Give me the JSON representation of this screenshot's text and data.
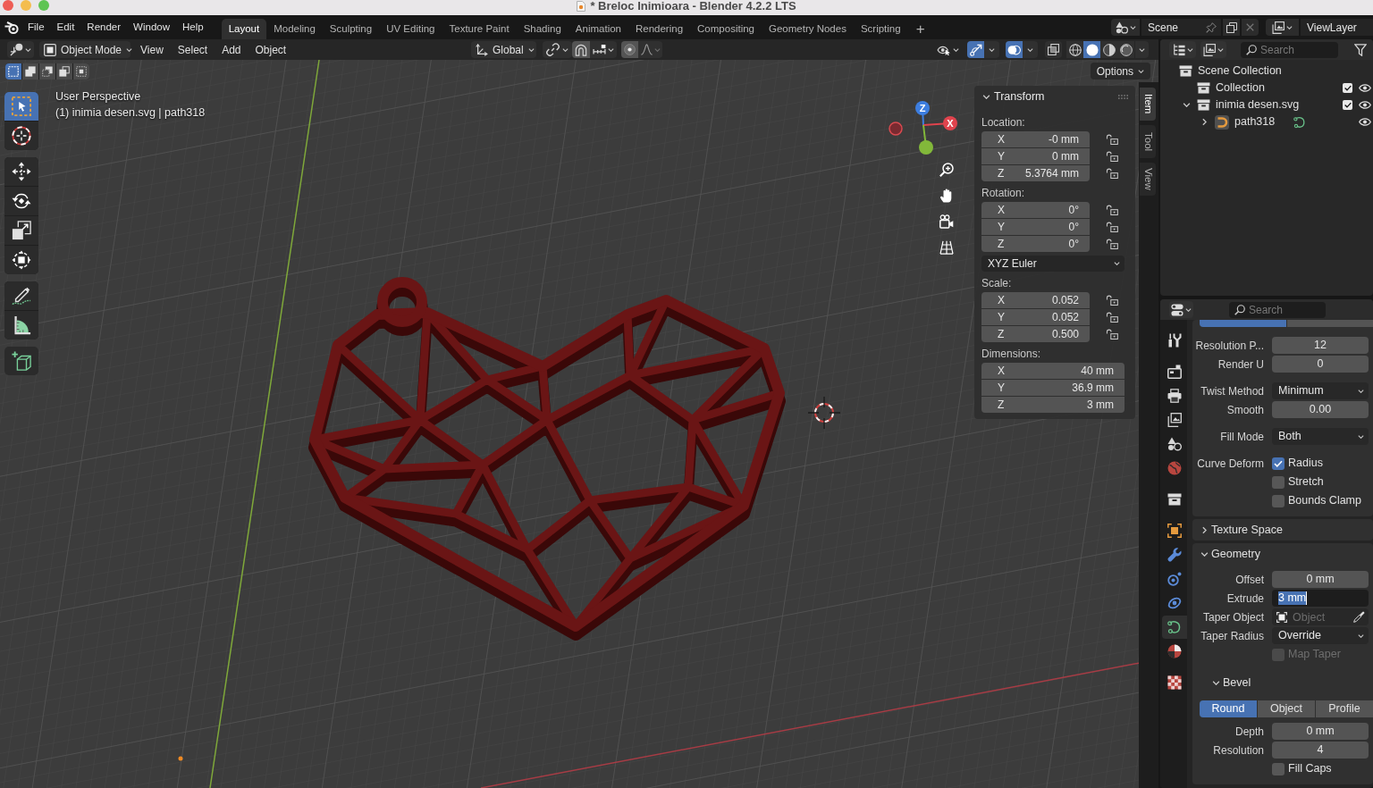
{
  "window": {
    "title": "* Breloc Inimioara - Blender 4.2.2 LTS"
  },
  "top_bar": {
    "menus": [
      "File",
      "Edit",
      "Render",
      "Window",
      "Help"
    ],
    "workspaces": [
      {
        "label": "Layout",
        "selected": true
      },
      {
        "label": "Modeling",
        "selected": false
      },
      {
        "label": "Sculpting",
        "selected": false
      },
      {
        "label": "UV Editing",
        "selected": false
      },
      {
        "label": "Texture Paint",
        "selected": false
      },
      {
        "label": "Shading",
        "selected": false
      },
      {
        "label": "Animation",
        "selected": false
      },
      {
        "label": "Rendering",
        "selected": false
      },
      {
        "label": "Compositing",
        "selected": false
      },
      {
        "label": "Geometry Nodes",
        "selected": false
      },
      {
        "label": "Scripting",
        "selected": false
      }
    ],
    "add_workspace": "+",
    "scene": "Scene",
    "view_layer": "ViewLayer"
  },
  "viewport": {
    "header": {
      "mode": "Object Mode",
      "menus": [
        "View",
        "Select",
        "Add",
        "Object"
      ],
      "orientation": "Global",
      "gizmos_on": true,
      "overlays_on": true,
      "shading": [
        {
          "kind": "wireframe",
          "selected": false
        },
        {
          "kind": "solid",
          "selected": true
        },
        {
          "kind": "material",
          "selected": false
        },
        {
          "kind": "rendered",
          "selected": false
        }
      ]
    },
    "select_modes": [
      {
        "kind": "set",
        "selected": true
      },
      {
        "kind": "extend",
        "selected": false
      },
      {
        "kind": "subtract",
        "selected": false
      },
      {
        "kind": "invert",
        "selected": false
      },
      {
        "kind": "intersect",
        "selected": false
      }
    ],
    "options": "Options",
    "view_name": "User Perspective",
    "object_info": "(1) inimia desen.svg | path318",
    "tool_groups": [
      [
        {
          "kind": "select",
          "selected": true
        },
        {
          "kind": "cursor",
          "selected": false
        }
      ],
      [
        {
          "kind": "move",
          "selected": false
        },
        {
          "kind": "rotate",
          "selected": false
        },
        {
          "kind": "scale",
          "selected": false
        },
        {
          "kind": "transform",
          "selected": false
        }
      ],
      [
        {
          "kind": "annotate",
          "selected": false
        },
        {
          "kind": "measure",
          "selected": false
        }
      ],
      [
        {
          "kind": "add_cube",
          "selected": false
        }
      ]
    ],
    "gizmo_labels": [
      "Z",
      "X"
    ],
    "sidebar": {
      "tabs": [
        {
          "label": "Item",
          "selected": true
        },
        {
          "label": "Tool",
          "selected": false
        },
        {
          "label": "View",
          "selected": false
        }
      ],
      "panel": {
        "title": "Transform",
        "expanded": true,
        "groups": [
          {
            "kind": "vector",
            "label": "Location:",
            "fields": [
              {
                "axis": "X",
                "value": "-0 mm",
                "locked": false
              },
              {
                "axis": "Y",
                "value": "0 mm",
                "locked": false
              },
              {
                "axis": "Z",
                "value": "5.3764 mm",
                "locked": false
              }
            ]
          },
          {
            "kind": "vector",
            "label": "Rotation:",
            "fields": [
              {
                "axis": "X",
                "value": "0°",
                "locked": false
              },
              {
                "axis": "Y",
                "value": "0°",
                "locked": false
              },
              {
                "axis": "Z",
                "value": "0°",
                "locked": false
              }
            ]
          },
          {
            "kind": "dropdown",
            "value": "XYZ Euler"
          },
          {
            "kind": "vector",
            "label": "Scale:",
            "fields": [
              {
                "axis": "X",
                "value": "0.052",
                "locked": false
              },
              {
                "axis": "Y",
                "value": "0.052",
                "locked": false
              },
              {
                "axis": "Z",
                "value": "0.500",
                "locked": false
              }
            ]
          },
          {
            "kind": "vector",
            "label": "Dimensions:",
            "fields": [
              {
                "axis": "X",
                "value": "40 mm"
              },
              {
                "axis": "Y",
                "value": "36.9 mm"
              },
              {
                "axis": "Z",
                "value": "3 mm"
              }
            ]
          }
        ]
      }
    }
  },
  "outliner": {
    "search_placeholder": "Search",
    "tree": [
      {
        "label": "Scene Collection",
        "kind": "scene_collection",
        "children": [
          {
            "label": "Collection",
            "kind": "collection",
            "checked": true,
            "visible": true
          },
          {
            "label": "inimia desen.svg",
            "kind": "collection",
            "expanded": true,
            "checked": true,
            "visible": true,
            "children": [
              {
                "label": "path318",
                "kind": "curve",
                "expanded": false,
                "visible": true
              }
            ]
          }
        ]
      }
    ]
  },
  "properties": {
    "search_placeholder": "Search",
    "tab_groups": [
      [
        {
          "kind": "tool",
          "selected": false
        }
      ],
      [
        {
          "kind": "render",
          "selected": false
        },
        {
          "kind": "output",
          "selected": false
        },
        {
          "kind": "view_layer",
          "selected": false
        },
        {
          "kind": "scene",
          "selected": false
        },
        {
          "kind": "world",
          "selected": false
        }
      ],
      [
        {
          "kind": "collection",
          "selected": false
        }
      ],
      [
        {
          "kind": "object",
          "selected": false
        },
        {
          "kind": "modifiers",
          "selected": false
        },
        {
          "kind": "particles",
          "selected": false
        },
        {
          "kind": "physics",
          "selected": false
        },
        {
          "kind": "data",
          "selected": true
        },
        {
          "kind": "material",
          "selected": false
        }
      ],
      [
        {
          "kind": "texture",
          "selected": false
        }
      ]
    ],
    "panels": [
      {
        "groups": [
          [
            {
              "kind": "segmented",
              "items": [
                {
                  "selected": true
                },
                {
                  "selected": false
                }
              ]
            }
          ],
          [
            {
              "kind": "number",
              "label": "Resolution P...",
              "value": "12"
            },
            {
              "kind": "number",
              "label": "Render U",
              "value": "0"
            }
          ],
          [
            {
              "kind": "dropdown",
              "label": "Twist Method",
              "value": "Minimum"
            },
            {
              "kind": "number",
              "label": "Smooth",
              "value": "0.00"
            }
          ],
          [
            {
              "kind": "dropdown",
              "label": "Fill Mode",
              "value": "Both"
            }
          ],
          [
            {
              "kind": "checkbox",
              "label": "Curve Deform",
              "text": "Radius",
              "checked": true,
              "disabled": false
            },
            {
              "kind": "checkbox",
              "text": "Stretch",
              "checked": false,
              "disabled": false
            },
            {
              "kind": "checkbox",
              "text": "Bounds Clamp",
              "checked": false,
              "disabled": false
            }
          ]
        ]
      },
      {
        "title": "Texture Space",
        "expanded": false
      },
      {
        "title": "Geometry",
        "expanded": true,
        "groups": [
          [
            {
              "kind": "number",
              "label": "Offset",
              "value": "0 mm"
            },
            {
              "kind": "editing",
              "label": "Extrude",
              "value": "3 mm"
            },
            {
              "kind": "object",
              "label": "Taper Object",
              "placeholder": "Object"
            },
            {
              "kind": "dropdown",
              "label": "Taper Radius",
              "value": "Override"
            },
            {
              "kind": "checkbox",
              "text": "Map Taper",
              "checked": false,
              "disabled": true
            }
          ]
        ],
        "subpanels": [
          {
            "title": "Bevel",
            "expanded": true,
            "groups": [
              [
                {
                  "kind": "segmented",
                  "items": [
                    {
                      "label": "Round",
                      "selected": true
                    },
                    {
                      "label": "Object",
                      "selected": false
                    },
                    {
                      "label": "Profile",
                      "selected": false
                    }
                  ]
                }
              ],
              [
                {
                  "kind": "number",
                  "label": "Depth",
                  "value": "0 mm"
                },
                {
                  "kind": "number",
                  "label": "Resolution",
                  "value": "4"
                },
                {
                  "kind": "checkbox",
                  "text": "Fill Caps",
                  "checked": false,
                  "disabled": false
                }
              ]
            ]
          }
        ]
      }
    ]
  }
}
